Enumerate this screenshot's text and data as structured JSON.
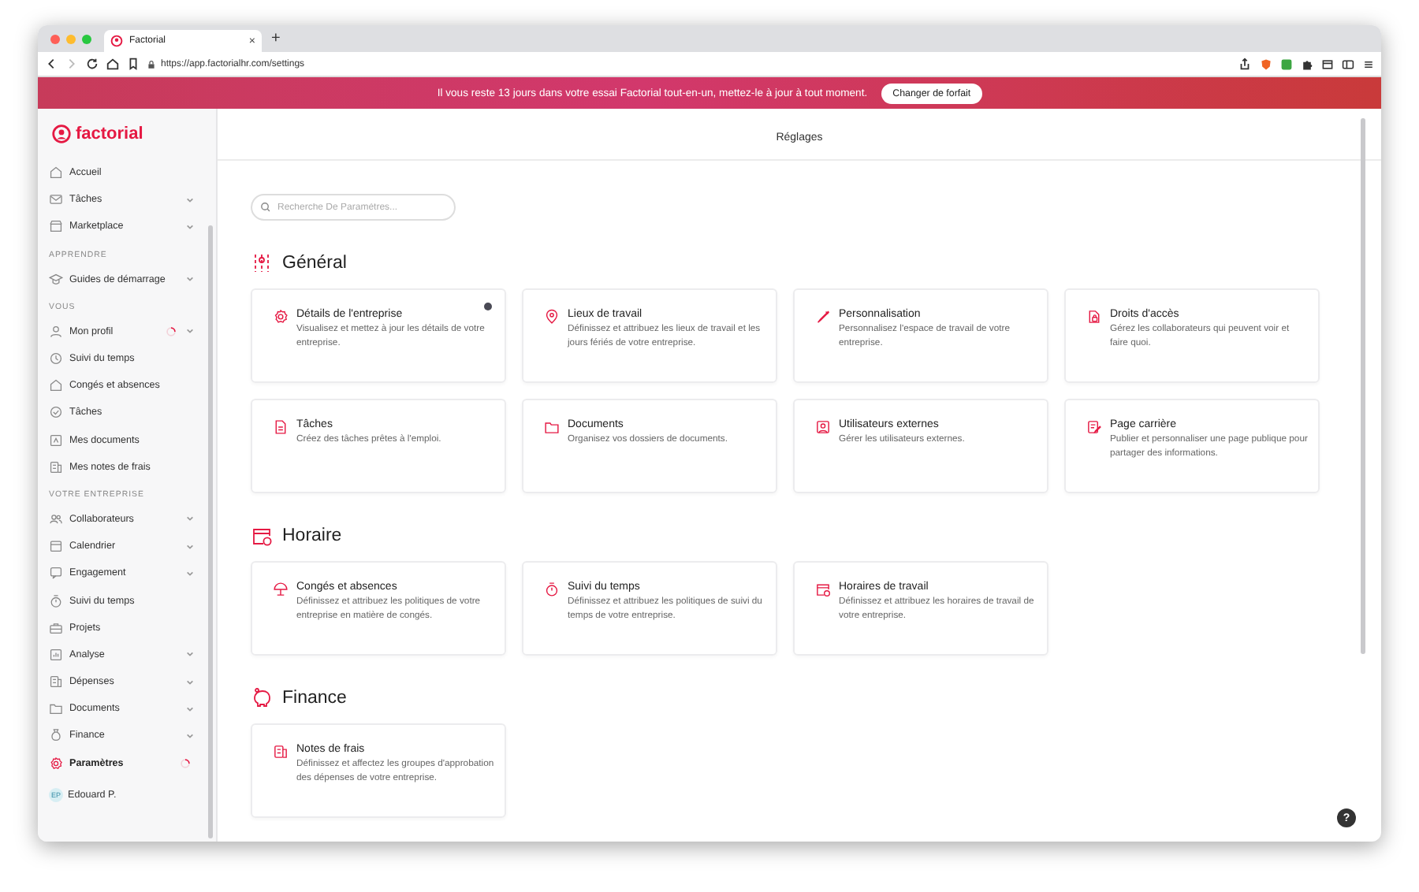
{
  "browser": {
    "tab": {
      "title": "Factorial",
      "close": "×"
    },
    "new_tab": "+",
    "url": "https://app.factorialhr.com/settings"
  },
  "banner": {
    "text": "Il vous reste 13 jours dans votre essai Factorial tout-en-un, mettez-le à jour à tout moment.",
    "button": "Changer de forfait"
  },
  "sidebar": {
    "logo": "factorial",
    "groups": [
      {
        "items": [
          {
            "label": "Accueil",
            "selected": false
          },
          {
            "label": "Tâches",
            "selected": false,
            "expanded": false
          },
          {
            "label": "Marketplace",
            "selected": false,
            "expanded": false
          }
        ]
      },
      {
        "heading": "APPRENDRE",
        "items": [
          {
            "label": "Guides de démarrage",
            "selected": false,
            "expanded": false
          }
        ]
      },
      {
        "heading": "VOUS",
        "items": [
          {
            "label": "Mon profil",
            "selected": false,
            "expanded": false,
            "loading": true
          },
          {
            "label": "Suivi du temps",
            "selected": false
          },
          {
            "label": "Congés et absences",
            "selected": false
          },
          {
            "label": "Tâches",
            "selected": false
          },
          {
            "label": "Mes documents",
            "selected": false
          },
          {
            "label": "Mes notes de frais",
            "selected": false
          }
        ]
      },
      {
        "heading": "VOTRE ENTREPRISE",
        "items": [
          {
            "label": "Collaborateurs",
            "selected": false,
            "expanded": false
          },
          {
            "label": "Calendrier",
            "selected": false,
            "expanded": false
          },
          {
            "label": "Engagement",
            "selected": false,
            "expanded": false
          },
          {
            "label": "Suivi du temps",
            "selected": false
          },
          {
            "label": "Projets",
            "selected": false
          },
          {
            "label": "Analyse",
            "selected": false,
            "expanded": false
          },
          {
            "label": "Dépenses",
            "selected": false,
            "expanded": false
          },
          {
            "label": "Documents",
            "selected": false,
            "expanded": false
          },
          {
            "label": "Finance",
            "selected": false,
            "expanded": false
          },
          {
            "label": "Paramètres",
            "selected": true,
            "loading": true
          }
        ]
      }
    ],
    "user": {
      "initials": "EP",
      "name": "Edouard P."
    }
  },
  "header": {
    "title": "Réglages"
  },
  "search": {
    "placeholder": "Recherche De Paramètres..."
  },
  "sections": [
    {
      "title": "Général",
      "cards": [
        {
          "title": "Détails de l'entreprise",
          "description": "Visualisez et mettez à jour les détails de votre entreprise.",
          "alert": true
        },
        {
          "title": "Lieux de travail",
          "description": "Définissez et attribuez les lieux de travail et les jours fériés de votre entreprise.",
          "alert": false
        },
        {
          "title": "Personnalisation",
          "description": "Personnalisez l'espace de travail de votre entreprise.",
          "alert": false
        },
        {
          "title": "Droits d'accès",
          "description": "Gérez les collaborateurs qui peuvent voir et faire quoi.",
          "alert": false
        },
        {
          "title": "Tâches",
          "description": "Créez des tâches prêtes à l'emploi.",
          "alert": false
        },
        {
          "title": "Documents",
          "description": "Organisez vos dossiers de documents.",
          "alert": false
        },
        {
          "title": "Utilisateurs externes",
          "description": "Gérer les utilisateurs externes.",
          "alert": false
        },
        {
          "title": "Page carrière",
          "description": "Publier et personnaliser une page publique pour partager des informations.",
          "alert": false
        }
      ]
    },
    {
      "title": "Horaire",
      "cards": [
        {
          "title": "Congés et absences",
          "description": "Définissez et attribuez les politiques de votre entreprise en matière de congés.",
          "alert": false
        },
        {
          "title": "Suivi du temps",
          "description": "Définissez et attribuez les politiques de suivi du temps de votre entreprise.",
          "alert": false
        },
        {
          "title": "Horaires de travail",
          "description": "Définissez et attribuez les horaires de travail de votre entreprise.",
          "alert": false
        }
      ]
    },
    {
      "title": "Finance",
      "cards": [
        {
          "title": "Notes de frais",
          "description": "Définissez et affectez les groupes d'approbation des dépenses de votre entreprise.",
          "alert": false
        }
      ]
    }
  ],
  "help": "?"
}
